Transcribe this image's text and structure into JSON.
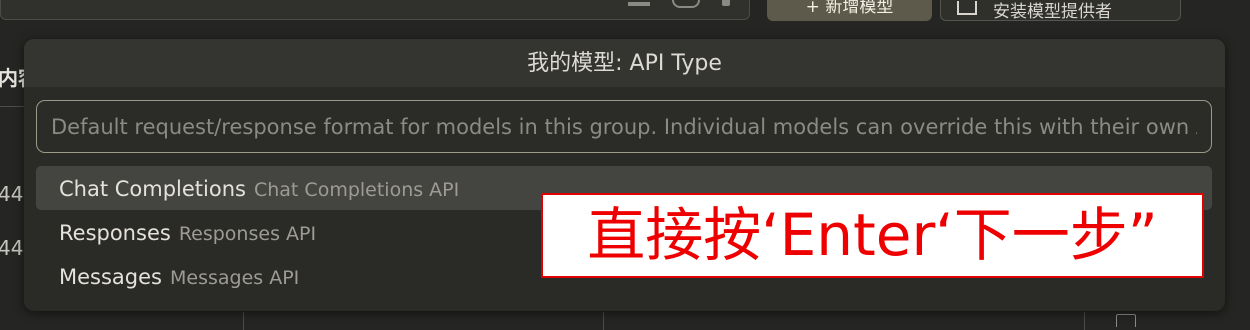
{
  "background": {
    "add_model_button": "+ 新增模型",
    "feedback_button": "安装模型提供者",
    "left_column_header": "内容",
    "left_cells": [
      "44",
      "44"
    ]
  },
  "dialog": {
    "title": "我的模型: API Type",
    "input": {
      "value": "",
      "placeholder": "Default request/response format for models in this group. Individual models can override this with their own API type setting."
    },
    "items": [
      {
        "label": "Chat Completions",
        "description": "Chat Completions API",
        "selected": true
      },
      {
        "label": "Responses",
        "description": "Responses API",
        "selected": false
      },
      {
        "label": "Messages",
        "description": "Messages API",
        "selected": false
      }
    ]
  },
  "annotation": {
    "text": "直接按‘Enter‘下一步”",
    "color": "#ee0000"
  }
}
